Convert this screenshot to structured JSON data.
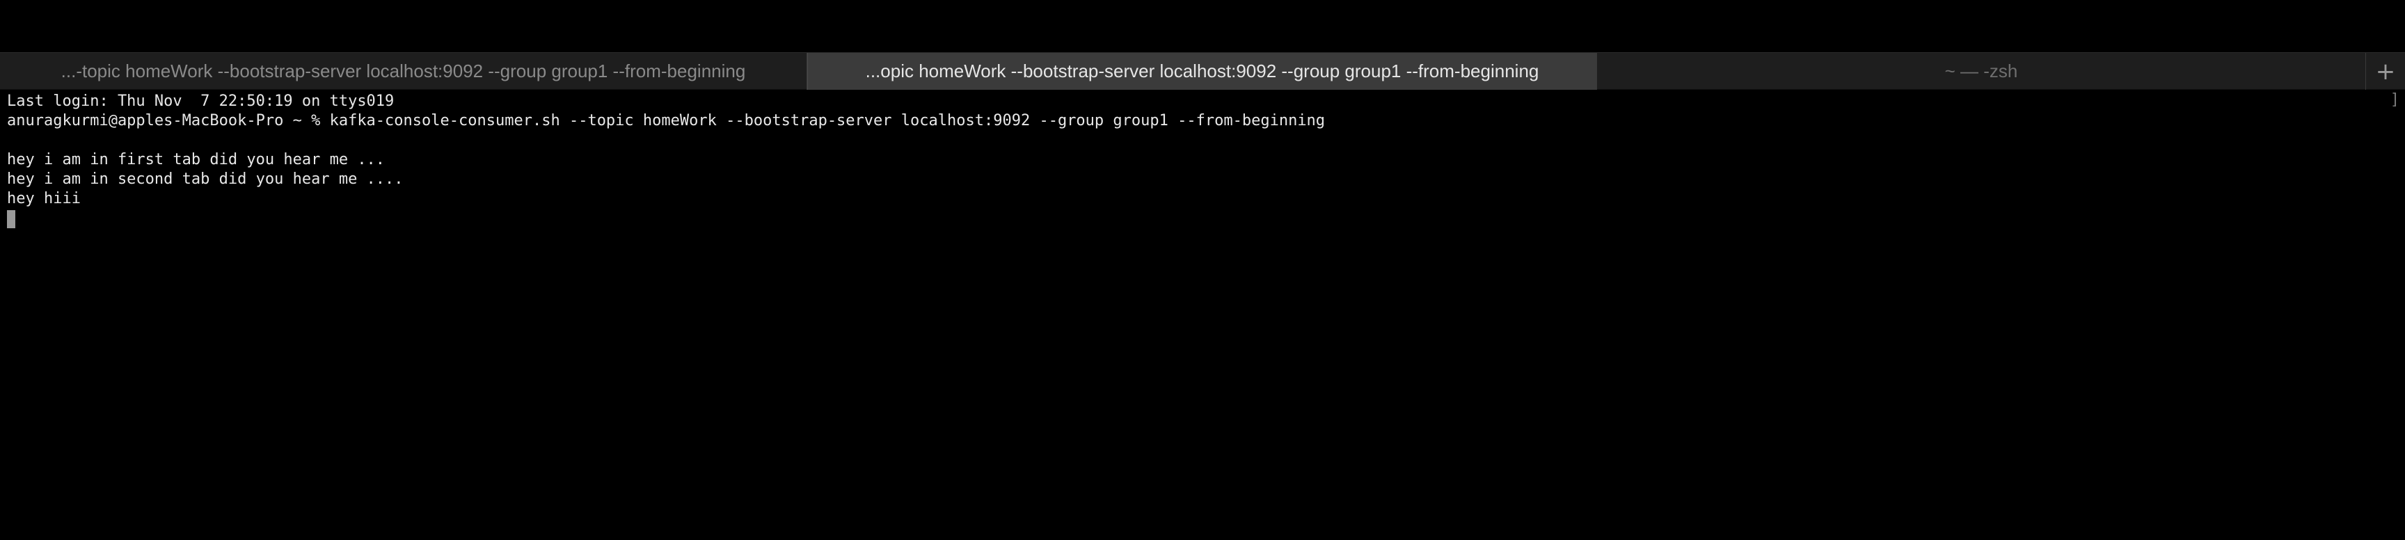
{
  "tabs": [
    {
      "label": "...-topic homeWork --bootstrap-server localhost:9092 --group group1 --from-beginning",
      "active": false
    },
    {
      "label": "...opic homeWork --bootstrap-server localhost:9092 --group group1 --from-beginning",
      "active": true
    },
    {
      "label": "~ — -zsh",
      "active": false
    }
  ],
  "new_tab_label": "+",
  "terminal": {
    "last_login": "Last login: Thu Nov  7 22:50:19 on ttys019",
    "prompt_command": "anuragkurmi@apples-MacBook-Pro ~ % kafka-console-consumer.sh --topic homeWork --bootstrap-server localhost:9092 --group group1 --from-beginning",
    "output": [
      "hey i am in first tab did you hear me ...",
      "hey i am in second tab did you hear me ....",
      "hey hiii"
    ],
    "scroll_mark": "]"
  },
  "colors": {
    "background": "#000000",
    "tabbar": "#1e1e1e",
    "active_tab": "#3b3b3b",
    "text": "#e8e8e8",
    "cursor": "#9a9a9a"
  }
}
